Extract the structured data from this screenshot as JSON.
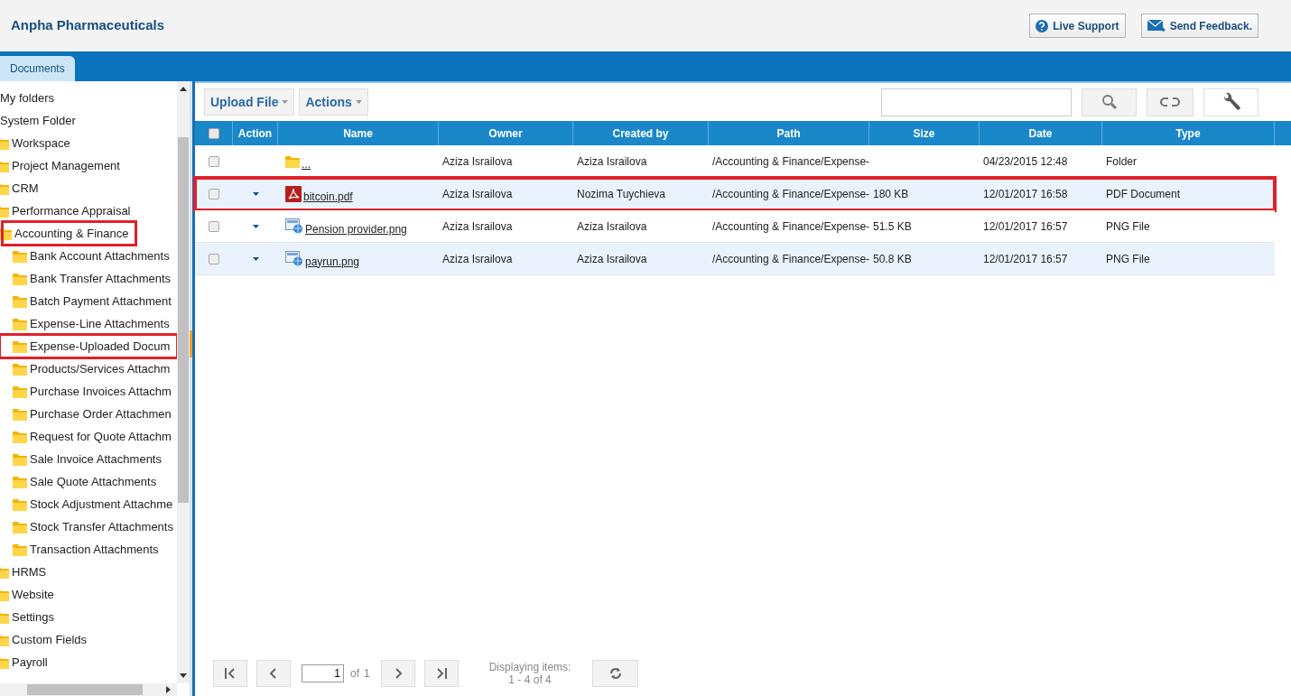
{
  "app": {
    "title": "Anpha Pharmaceuticals"
  },
  "header_buttons": [
    {
      "label": "Live Support",
      "kind": "help"
    },
    {
      "label": "Send Feedback.",
      "kind": "feedback"
    }
  ],
  "tabs": [
    {
      "label": "Documents",
      "selected": true
    }
  ],
  "folder_tree": [
    {
      "label": "My folders",
      "kind": "root",
      "highlighted": false
    },
    {
      "label": "System Folder",
      "kind": "root",
      "highlighted": false
    },
    {
      "label": "Workspace",
      "kind": "folder",
      "highlighted": false
    },
    {
      "label": "Project Management",
      "kind": "folder",
      "highlighted": false
    },
    {
      "label": "CRM",
      "kind": "folder",
      "highlighted": false
    },
    {
      "label": "Performance Appraisal",
      "kind": "folder",
      "highlighted": false
    },
    {
      "label": "Accounting & Finance",
      "kind": "folder",
      "highlighted": true,
      "children": [
        {
          "label": "Bank Account Attachments",
          "kind": "folder",
          "highlighted": false
        },
        {
          "label": "Bank Transfer Attachments",
          "kind": "folder",
          "highlighted": false
        },
        {
          "label": "Batch Payment Attachment",
          "kind": "folder",
          "highlighted": false
        },
        {
          "label": "Expense-Line Attachments",
          "kind": "folder",
          "highlighted": false
        },
        {
          "label": "Expense-Uploaded Docum",
          "kind": "folder",
          "highlighted": true
        },
        {
          "label": "Products/Services Attachm",
          "kind": "folder",
          "highlighted": false
        },
        {
          "label": "Purchase Invoices Attachm",
          "kind": "folder",
          "highlighted": false
        },
        {
          "label": "Purchase Order Attachmen",
          "kind": "folder",
          "highlighted": false
        },
        {
          "label": "Request for Quote Attachm",
          "kind": "folder",
          "highlighted": false
        },
        {
          "label": "Sale Invoice Attachments",
          "kind": "folder",
          "highlighted": false
        },
        {
          "label": "Sale Quote Attachments",
          "kind": "folder",
          "highlighted": false
        },
        {
          "label": "Stock Adjustment Attachme",
          "kind": "folder",
          "highlighted": false
        },
        {
          "label": "Stock Transfer Attachments",
          "kind": "folder",
          "highlighted": false
        },
        {
          "label": "Transaction Attachments",
          "kind": "folder",
          "highlighted": false
        }
      ]
    },
    {
      "label": "HRMS",
      "kind": "folder",
      "highlighted": false
    },
    {
      "label": "Website",
      "kind": "folder",
      "highlighted": false
    },
    {
      "label": "Settings",
      "kind": "folder",
      "highlighted": false
    },
    {
      "label": "Custom Fields",
      "kind": "folder",
      "highlighted": false
    },
    {
      "label": "Payroll",
      "kind": "folder",
      "highlighted": false
    }
  ],
  "toolbar": {
    "buttons": [
      "Upload File",
      "Actions"
    ]
  },
  "table": {
    "select_all": {
      "checked": false
    },
    "columns": [
      "Action",
      "Name",
      "Owner",
      "Created by",
      "Path",
      "Size",
      "Date",
      "Type"
    ],
    "rows": [
      {
        "checked": false,
        "has_menu": false,
        "kind": "folder",
        "name": "...",
        "owner": "Aziza Israilova",
        "created_by": "Aziza Israilova",
        "path": "/Accounting & Finance/Expense-",
        "date": "04/23/2015 12:48",
        "type": "Folder",
        "highlighted": false
      },
      {
        "checked": false,
        "has_menu": true,
        "kind": "pdf",
        "name": "bitcoin.pdf",
        "owner": "Aziza Israilova",
        "created_by": "Nozima Tuychieva",
        "path": "/Accounting & Finance/Expense-",
        "size": "180 KB",
        "date": "12/01/2017 16:58",
        "type": "PDF Document",
        "highlighted": true
      },
      {
        "checked": false,
        "has_menu": true,
        "kind": "image",
        "name": "Pension provider.png",
        "owner": "Aziza Israilova",
        "created_by": "Aziza Israilova",
        "path": "/Accounting & Finance/Expense-",
        "size": "51.5 KB",
        "date": "12/01/2017 16:57",
        "type": "PNG File",
        "highlighted": false
      },
      {
        "checked": false,
        "has_menu": true,
        "kind": "image",
        "name": "payrun.png",
        "owner": "Aziza Israilova",
        "created_by": "Aziza Israilova",
        "path": "/Accounting & Finance/Expense-",
        "size": "50.8 KB",
        "date": "12/01/2017 16:57",
        "type": "PNG File",
        "highlighted": false
      }
    ]
  },
  "pager": {
    "page": "1",
    "of_label": "of",
    "page_count": "1",
    "summary": [
      "Displaying items:",
      "1 - 4 of 4"
    ]
  }
}
